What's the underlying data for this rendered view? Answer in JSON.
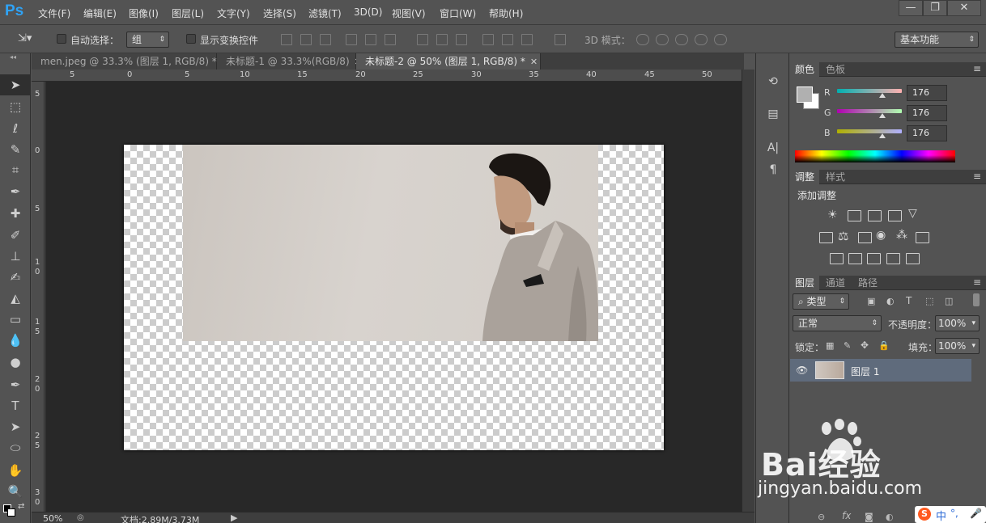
{
  "app": {
    "logo": "Ps"
  },
  "menus": [
    "文件(F)",
    "编辑(E)",
    "图像(I)",
    "图层(L)",
    "文字(Y)",
    "选择(S)",
    "滤镜(T)",
    "3D(D)",
    "视图(V)",
    "窗口(W)",
    "帮助(H)"
  ],
  "window_controls": {
    "minimize": "—",
    "restore": "❐",
    "close": "✕"
  },
  "options": {
    "auto_select_label": "自动选择：",
    "auto_select_value": "组",
    "show_transform_label": "显示变换控件",
    "mode3d_label": "3D 模式：",
    "workspace_value": "基本功能"
  },
  "tabs": [
    {
      "label": "men.jpeg @ 33.3% (图层 1, RGB/8) *",
      "close": "✕",
      "active": false
    },
    {
      "label": "未标题-1 @ 33.3%(RGB/8)",
      "close": "✕",
      "active": false
    },
    {
      "label": "未标题-2 @ 50% (图层 1, RGB/8) *",
      "close": "✕",
      "active": true
    }
  ],
  "ruler_h_labels": [
    "5",
    "0",
    "5",
    "10",
    "15",
    "20",
    "25",
    "30",
    "35",
    "40",
    "45",
    "50"
  ],
  "ruler_v_labels": [
    "5",
    "0",
    "5",
    "1 0",
    "1 5",
    "2 0",
    "2 5",
    "3 0"
  ],
  "status": {
    "zoom": "50%",
    "doc_info": "文档:2.89M/3.73M"
  },
  "color_panel": {
    "tabs": [
      "颜色",
      "色板"
    ],
    "channels": [
      {
        "name": "R",
        "value": "176"
      },
      {
        "name": "G",
        "value": "176"
      },
      {
        "name": "B",
        "value": "176"
      }
    ]
  },
  "adjust_panel": {
    "tabs": [
      "调整",
      "样式"
    ],
    "title": "添加调整"
  },
  "layers_panel": {
    "tabs": [
      "图层",
      "通道",
      "路径"
    ],
    "filter_value": "类型",
    "blend_mode": "正常",
    "opacity_label": "不透明度：",
    "opacity_value": "100%",
    "lock_label": "锁定：",
    "fill_label": "填充：",
    "fill_value": "100%",
    "layer_name": "图层 1"
  },
  "watermark": {
    "brand": "Bai经验",
    "url": "jingyan.baidu.com"
  },
  "ime": {
    "text": "中",
    "punct": "°,"
  },
  "colors": {
    "accent": "#2fa3f6",
    "selected_layer": "#5f6b7c",
    "canvas_bg": "#282828"
  }
}
